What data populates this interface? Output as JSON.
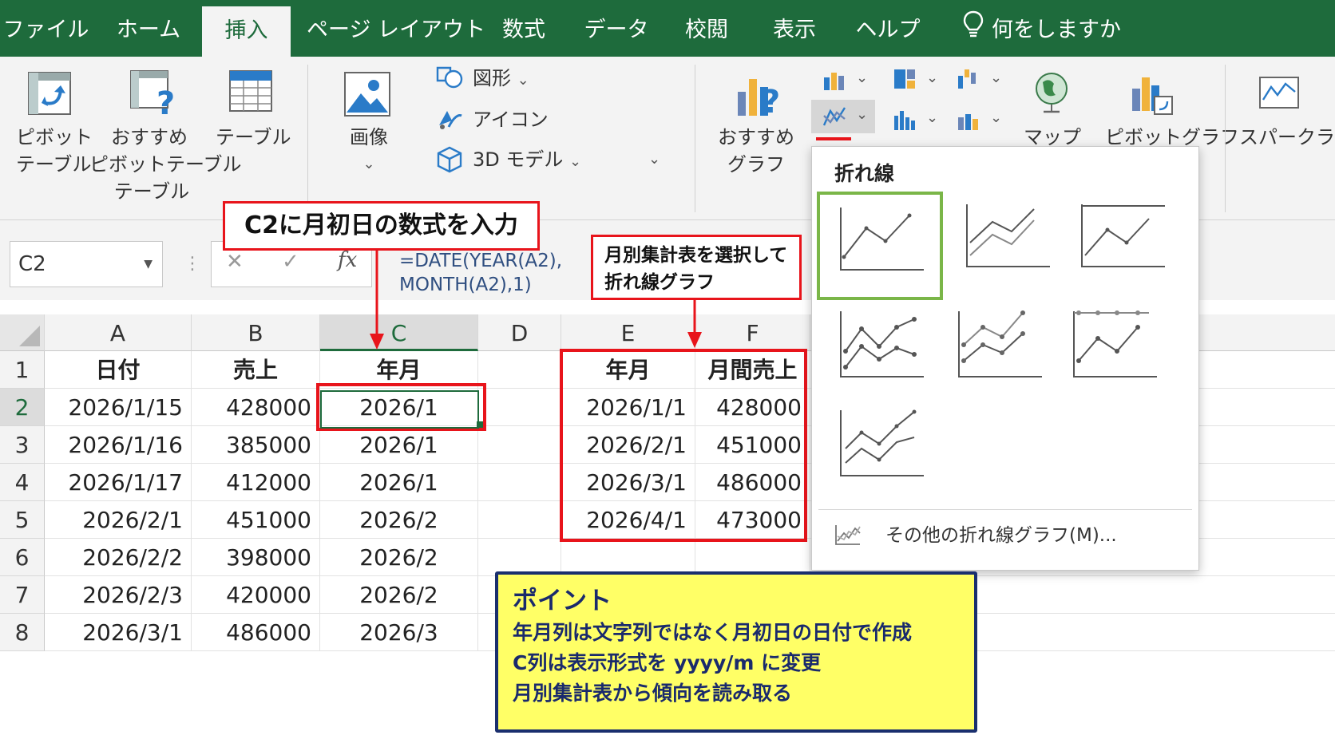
{
  "tabs": [
    {
      "label": "ファイル",
      "active": false
    },
    {
      "label": "ホーム",
      "active": false
    },
    {
      "label": "挿入",
      "active": true
    },
    {
      "label": "ページ レイアウト",
      "active": false
    },
    {
      "label": "数式",
      "active": false
    },
    {
      "label": "データ",
      "active": false
    },
    {
      "label": "校閲",
      "active": false
    },
    {
      "label": "表示",
      "active": false
    },
    {
      "label": "ヘルプ",
      "active": false
    }
  ],
  "tell_me": "何をしますか",
  "ribbon": {
    "pivot_table": [
      "ピボット",
      "テーブル"
    ],
    "recommended_pivot": [
      "おすすめ",
      "ピボットテーブル"
    ],
    "table": "テーブル",
    "group_tables": "テーブル",
    "image": "画像",
    "shapes": "図形",
    "icons": "アイコン",
    "models_3d": "3D モデル",
    "recommended_charts": [
      "おすすめ",
      "グラフ"
    ],
    "maps": "マップ",
    "pivot_chart": "ピボットグラフ",
    "sparklines": "スパークライン",
    "accent_color": "#1e6b3c"
  },
  "formula_bar": {
    "name_box": "C2",
    "cancel": "✕",
    "enter": "✓",
    "fx": "fx",
    "formula_line1": "=DATE(YEAR(A2),",
    "formula_line2": " MONTH(A2),1)"
  },
  "grid": {
    "columns": [
      "A",
      "B",
      "C",
      "D",
      "E",
      "F"
    ],
    "rows": [
      "1",
      "2",
      "3",
      "4",
      "5",
      "6",
      "7",
      "8"
    ],
    "headers": {
      "a": "日付",
      "b": "売上",
      "c": "年月",
      "e": "年月",
      "f": "月間売上"
    },
    "data": [
      {
        "a": "2026/1/15",
        "b": "428000",
        "c": "2026/1"
      },
      {
        "a": "2026/1/16",
        "b": "385000",
        "c": "2026/1"
      },
      {
        "a": "2026/1/17",
        "b": "412000",
        "c": "2026/1"
      },
      {
        "a": "2026/2/1",
        "b": "451000",
        "c": "2026/2"
      },
      {
        "a": "2026/2/2",
        "b": "398000",
        "c": "2026/2"
      },
      {
        "a": "2026/2/3",
        "b": "420000",
        "c": "2026/2"
      },
      {
        "a": "2026/3/1",
        "b": "486000",
        "c": "2026/3"
      }
    ],
    "summary": [
      {
        "e": "2026/1/1",
        "f": "428000"
      },
      {
        "e": "2026/2/1",
        "f": "451000"
      },
      {
        "e": "2026/3/1",
        "f": "486000"
      },
      {
        "e": "2026/4/1",
        "f": "473000"
      }
    ],
    "active_cell": "C2"
  },
  "callouts": {
    "c2": "C2に月初日の数式を入力",
    "chart_line1": "月別集計表を選択して",
    "chart_line2": "折れ線グラフ",
    "highlight_color": "#e8141b"
  },
  "dropdown": {
    "title": "折れ線",
    "more": "その他の折れ線グラフ(M)..."
  },
  "point": {
    "title": "ポイント",
    "lines": [
      "年月列は文字列ではなく月初日の日付で作成",
      "C列は表示形式を yyyy/m に変更",
      "月別集計表から傾向を読み取る"
    ]
  }
}
